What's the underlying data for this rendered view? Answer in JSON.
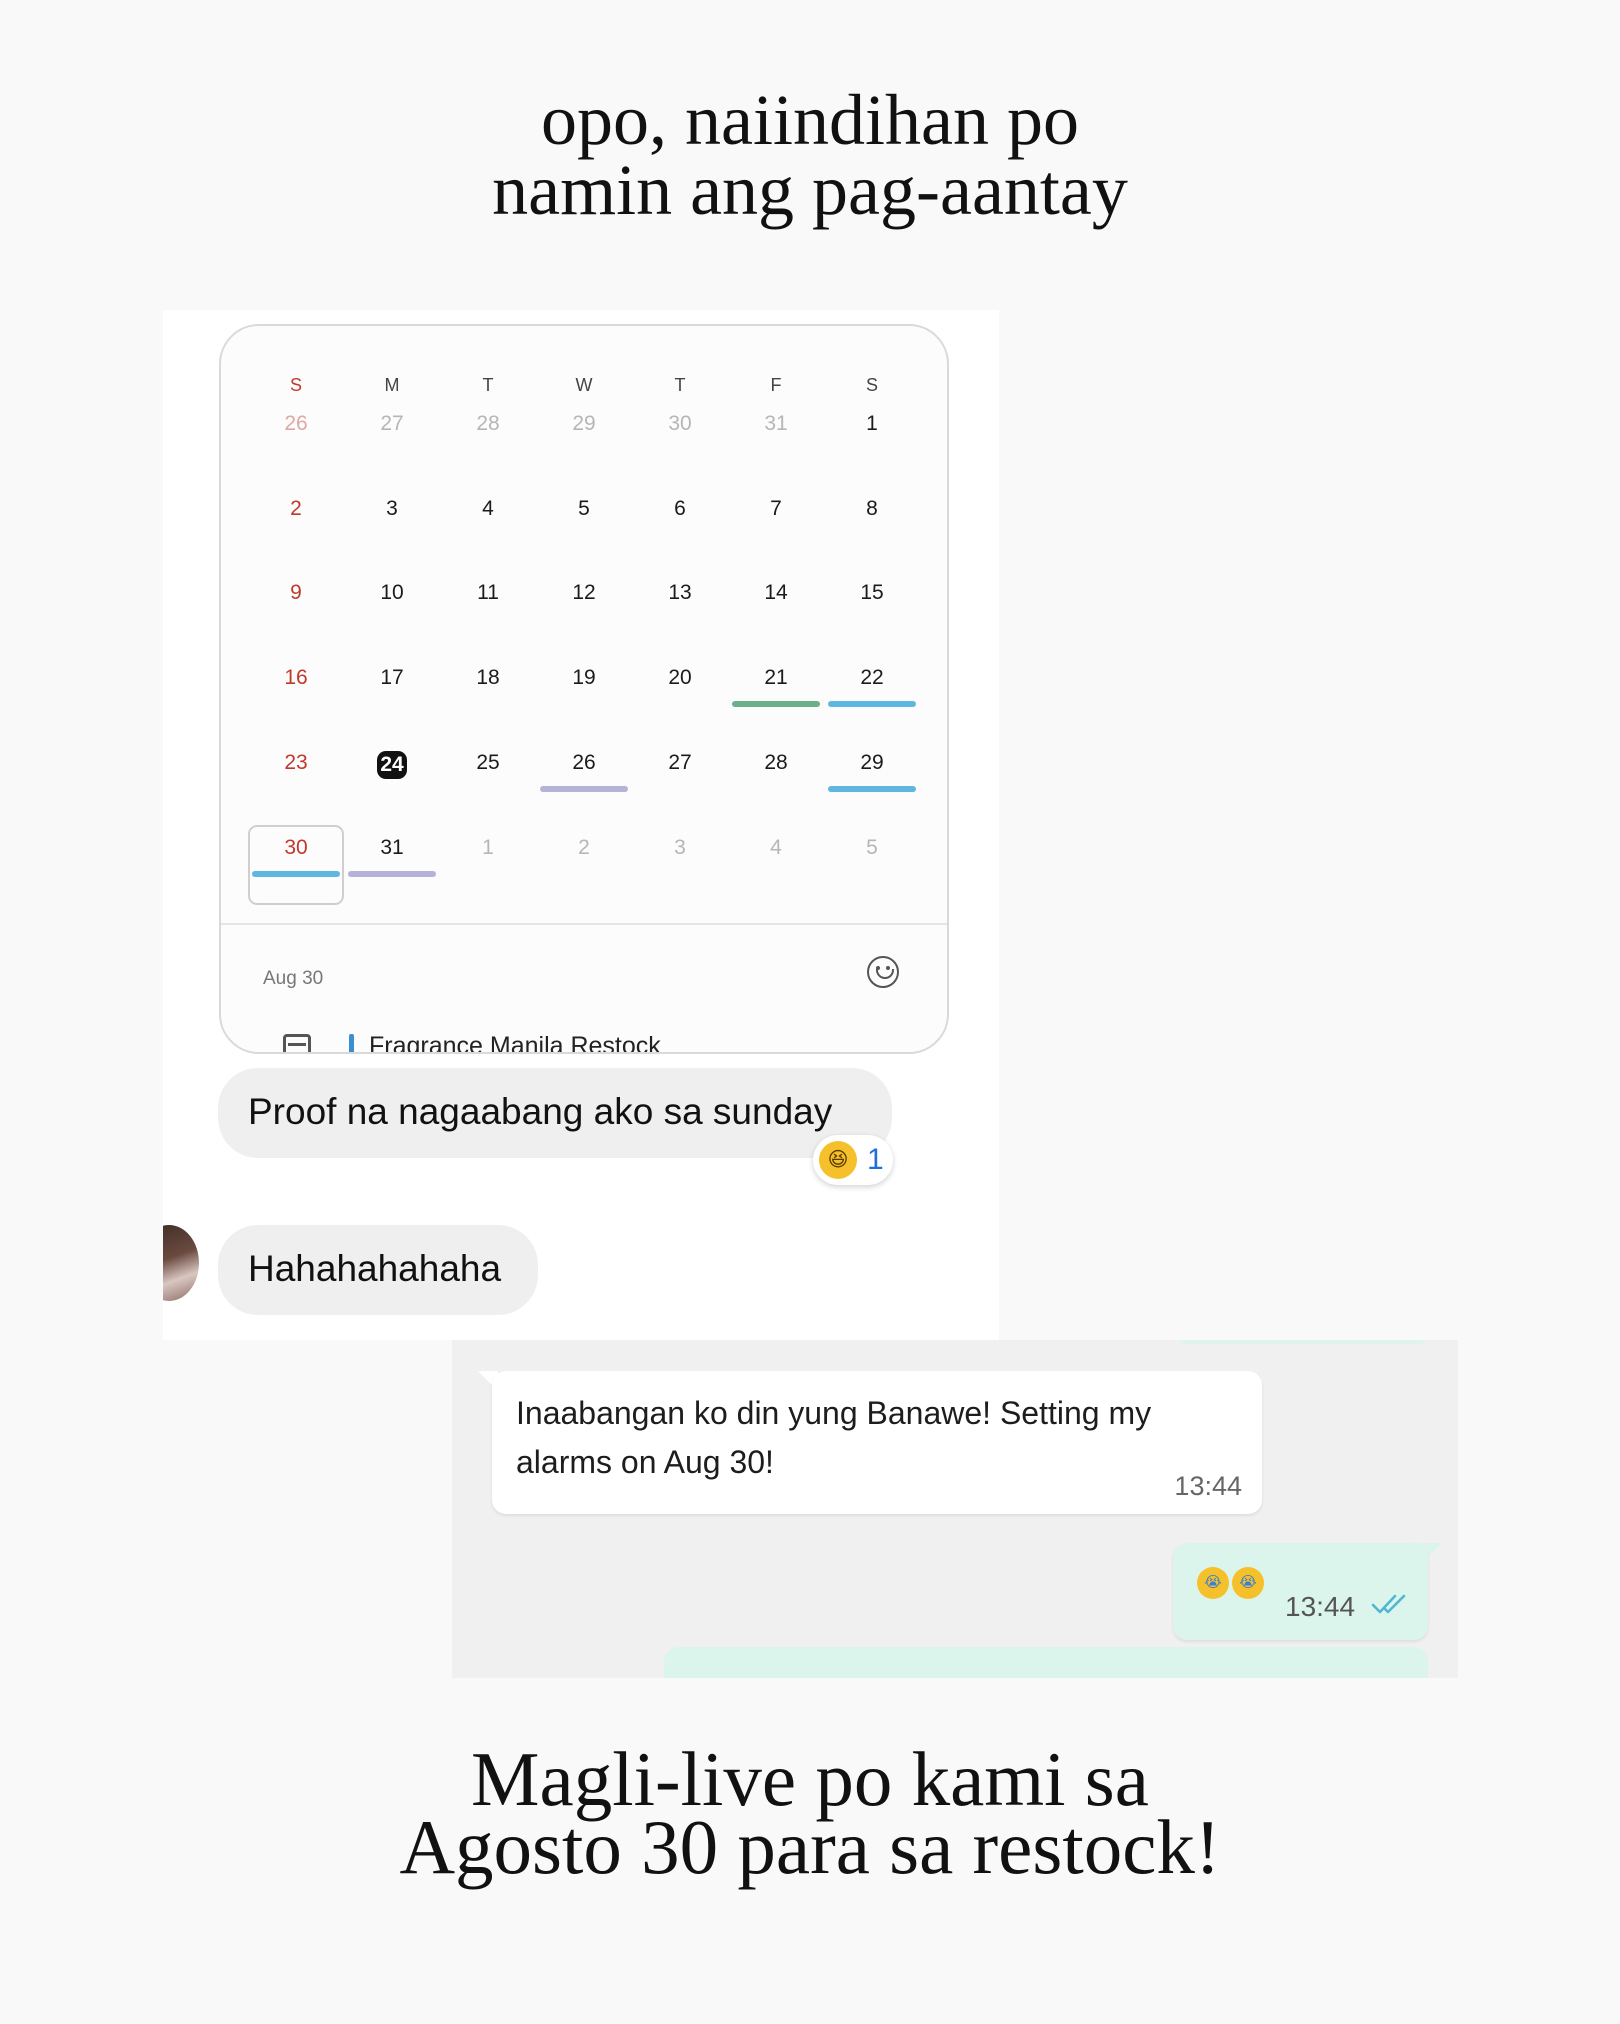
{
  "captions": {
    "top": [
      "opo, naiindihan po",
      "namin ang pag-aantay"
    ],
    "bottom": [
      "Magli-live po kami sa",
      "Agosto 30 para sa restock!"
    ]
  },
  "calendar": {
    "weekdays": [
      "S",
      "M",
      "T",
      "W",
      "T",
      "F",
      "S"
    ],
    "weeks": [
      [
        "26",
        "27",
        "28",
        "29",
        "30",
        "31",
        "1"
      ],
      [
        "2",
        "3",
        "4",
        "5",
        "6",
        "7",
        "8"
      ],
      [
        "9",
        "10",
        "11",
        "12",
        "13",
        "14",
        "15"
      ],
      [
        "16",
        "17",
        "18",
        "19",
        "20",
        "21",
        "22"
      ],
      [
        "23",
        "24",
        "25",
        "26",
        "27",
        "28",
        "29"
      ],
      [
        "30",
        "31",
        "1",
        "2",
        "3",
        "4",
        "5"
      ]
    ],
    "today": "24",
    "selected": "30",
    "selected_date_label": "Aug 30",
    "event_title": "Fragrance Manila Restock",
    "event_colors": {
      "green": "#6aaf88",
      "blue": "#5fb6e0",
      "purple": "#b5b2d8"
    }
  },
  "chat1": {
    "message_1": "Proof na nagaabang ako sa sunday",
    "reaction_emoji": "😆",
    "reaction_count": "1",
    "message_2": "Hahahahahaha"
  },
  "chat2": {
    "incoming_text": "Inaabangan ko din yung Banawe! Setting my alarms on Aug 30!",
    "incoming_time": "13:44",
    "outgoing_emojis": [
      "😭",
      "😭"
    ],
    "outgoing_time": "13:44",
    "read_icon": "double-check-icon",
    "read_color": "#4fb8d0"
  }
}
